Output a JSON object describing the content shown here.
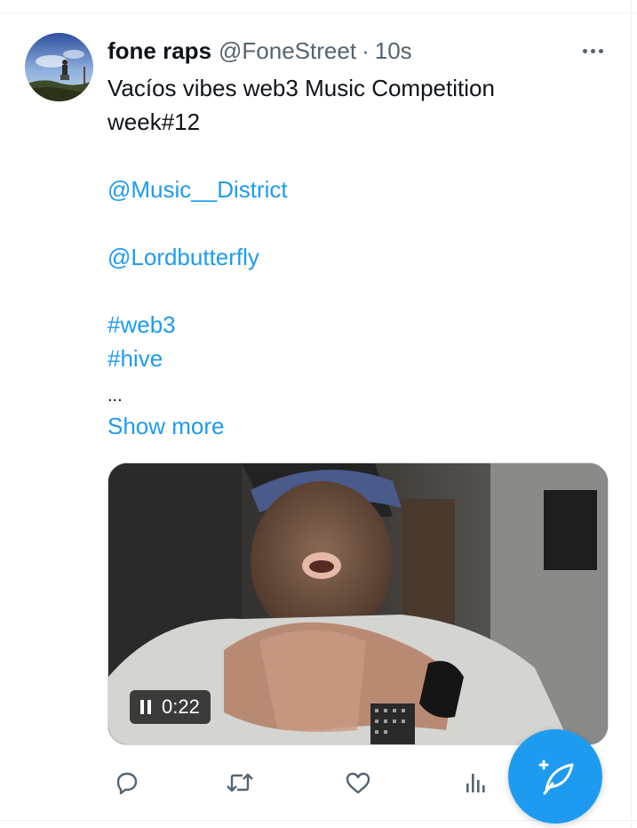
{
  "tweet": {
    "display_name": "fone raps",
    "handle": "@FoneStreet",
    "separator": "·",
    "time": "10s",
    "lines": [
      "Vacíos vibes web3 Music Competition",
      "week#12"
    ],
    "mentions": [
      "@Music__District",
      "@Lordbutterfly"
    ],
    "hashtags": [
      "#web3",
      "#hive"
    ],
    "ellipsis": "...",
    "show_more": "Show more"
  },
  "video": {
    "time": "0:22",
    "state": "playing"
  },
  "actions": [
    "reply-icon",
    "retweet-icon",
    "like-icon",
    "views-icon"
  ],
  "colors": {
    "accent": "#1d9bf0",
    "text": "#0f1419",
    "muted": "#536471"
  }
}
